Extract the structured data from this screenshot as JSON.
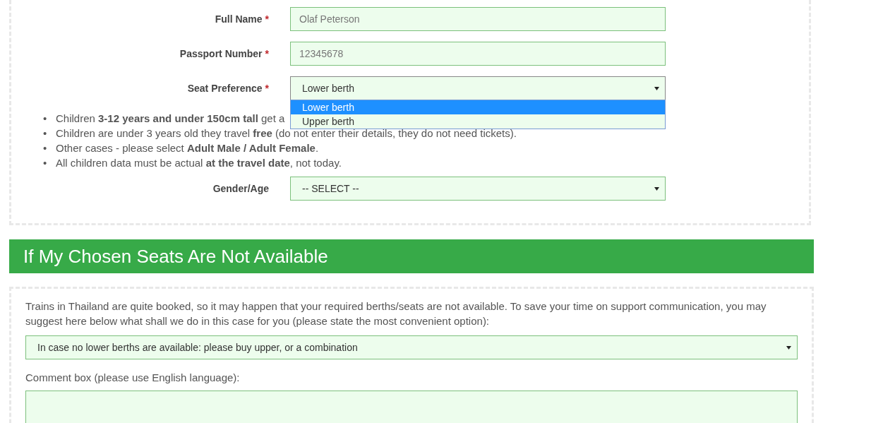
{
  "passenger_form": {
    "fields": [
      {
        "kind": "text",
        "label": "Full Name",
        "required_mark": "*",
        "placeholder": "Olaf Peterson"
      },
      {
        "kind": "text",
        "label": "Passport Number",
        "required_mark": "*",
        "placeholder": "12345678"
      },
      {
        "kind": "select",
        "label": "Seat Preference",
        "required_mark": "*",
        "value": "Lower berth",
        "expanded": true,
        "options": [
          {
            "label": "Lower berth",
            "selected": true
          },
          {
            "label": "Upper berth",
            "selected": false
          }
        ]
      }
    ],
    "notes": [
      {
        "bullet": "•",
        "text": "Children **3-12 years and under 150cm tall** get a"
      },
      {
        "bullet": "•",
        "text": "Children are under 3 years old they travel **free** (do not enter their details, they do not need tickets)."
      },
      {
        "bullet": "•",
        "text": "Other cases - please select **Adult Male / Adult Female**."
      },
      {
        "bullet": "•",
        "text": "All children data must be actual **at the travel date**, not today."
      }
    ],
    "gender": {
      "kind": "select",
      "label": "Gender/Age",
      "value": "-- SELECT --",
      "expanded": false
    }
  },
  "unavailable_section": {
    "title": "If My Chosen Seats Are Not Available",
    "description": "Trains in Thailand are quite booked, so it may happen that your required berths/seats are not available. To save your time on support communication, you may suggest here below what shall we do in this case for you (please state the most convenient option):",
    "option_select": {
      "value": "In case no lower berths are available: please buy upper, or a combination"
    },
    "comment_label": "Comment box (please use English language):"
  }
}
